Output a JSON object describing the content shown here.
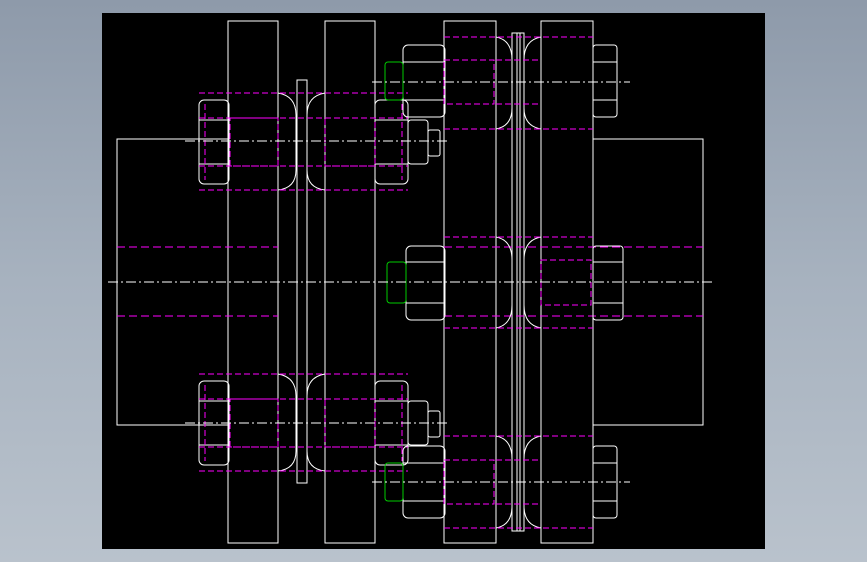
{
  "drawing": {
    "background": "#000000",
    "colors": {
      "visible_edge": "#ffffff",
      "hidden_edge": "#ff00ff",
      "center_line": "#ffffff",
      "thread_detail": "#00cc00"
    }
  }
}
